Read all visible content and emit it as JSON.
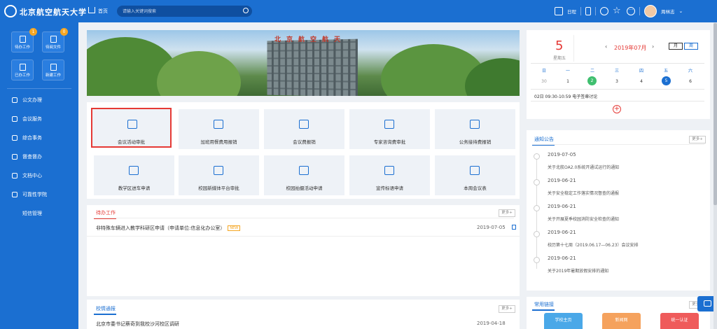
{
  "topbar": {
    "logo_text": "北京航空航天大学",
    "home_label": "首页",
    "search_placeholder": "请输入关键词搜索",
    "schedule_label": "日程",
    "user_name": "周林志",
    "icons": [
      "calendar-icon",
      "phone-icon",
      "gear-icon",
      "star-icon",
      "more-icon",
      "chevron-down-icon"
    ]
  },
  "sidebar": {
    "quick": [
      {
        "label": "待办工作",
        "badge": "1"
      },
      {
        "label": "待阅文件",
        "badge": "0"
      },
      {
        "label": "已办工作"
      },
      {
        "label": "新建工作"
      }
    ],
    "menu": [
      "公文办理",
      "会议服务",
      "综合事务",
      "督查督办",
      "文档中心",
      "可靠性学院",
      "短信管理"
    ]
  },
  "banner": {
    "sign_text": "北京航空航天"
  },
  "tiles": [
    "会议活动审批",
    "加班用餐费用报销",
    "会议费报销",
    "专家咨询费审批",
    "公务接待费报销",
    "教学区进车申请",
    "校园新媒体平台审批",
    "校园拍摄活动申请",
    "宣传标语申请",
    "本周会议表"
  ],
  "todo": {
    "title": "待办工作",
    "more": "更多+",
    "item": "非特殊车辆进入教学科研区申请（申请单位:信息化办公室）",
    "new_tag": "NEW",
    "date": "2019-07-05"
  },
  "bulletin": {
    "title": "校情通报",
    "more": "更多+",
    "item": "北京市委书记蔡奇到我校沙河校区调研",
    "date": "2019-04-18"
  },
  "calendar": {
    "day": "5",
    "weekday": "星期五",
    "month": "2019年07月",
    "prev": "‹",
    "next": "›",
    "view_month": "月",
    "view_week": "周",
    "week_headers": [
      "日",
      "一",
      "二",
      "三",
      "四",
      "五",
      "六"
    ],
    "days": [
      "30",
      "1",
      "2",
      "3",
      "4",
      "5",
      "6"
    ],
    "event": "02日  09:30-10:59    电子签章讨论"
  },
  "notices": {
    "title": "通知公告",
    "more": "更多+",
    "items": [
      {
        "date": "2019-07-05",
        "title": "关于北航OA2.0系统开通试运行的通知"
      },
      {
        "date": "2019-06-21",
        "title": "关于安全稳定工作落实情况督查的通报"
      },
      {
        "date": "2019-06-21",
        "title": "关于开展夏季校园消防安全检查的通知"
      },
      {
        "date": "2019-06-21",
        "title": "校历第十七周（2019.06.17—06.23）会议安排"
      },
      {
        "date": "2019-06-21",
        "title": "关于2019年暑期放假安排的通知"
      }
    ]
  },
  "links": {
    "title": "常用链接",
    "more": "更多+",
    "items": [
      {
        "label": "学校主页",
        "color": "#4aa8e8"
      },
      {
        "label": "新闻网",
        "color": "#f5a25d"
      },
      {
        "label": "统一认证",
        "color": "#ef5b5b"
      }
    ]
  },
  "colors": {
    "primary": "#1b6fd1",
    "accent": "#e53935",
    "badge": "#f5a623"
  }
}
